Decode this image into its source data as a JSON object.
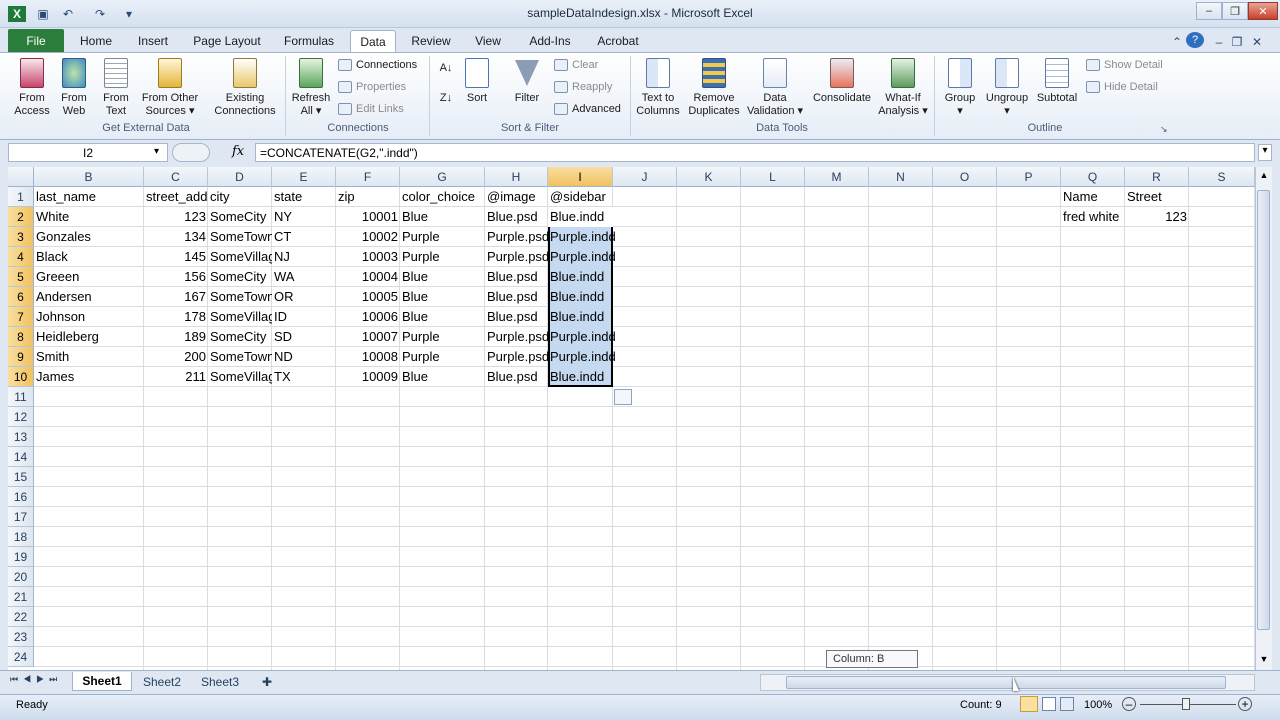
{
  "window": {
    "title": "sampleDataIndesign.xlsx  -  Microsoft Excel"
  },
  "tabs": [
    "File",
    "Home",
    "Insert",
    "Page Layout",
    "Formulas",
    "Data",
    "Review",
    "View",
    "Add-Ins",
    "Acrobat"
  ],
  "ribbon": {
    "get_external": {
      "from_access": "From\nAccess",
      "from_web": "From\nWeb",
      "from_text": "From\nText",
      "from_other": "From Other\nSources ▾",
      "existing": "Existing\nConnections",
      "label": "Get External Data"
    },
    "connections": {
      "refresh": "Refresh\nAll ▾",
      "connections": "Connections",
      "properties": "Properties",
      "edit_links": "Edit Links",
      "label": "Connections"
    },
    "sort_filter": {
      "sort": "Sort",
      "filter": "Filter",
      "clear": "Clear",
      "reapply": "Reapply",
      "advanced": "Advanced",
      "label": "Sort & Filter"
    },
    "data_tools": {
      "text_to_columns": "Text to\nColumns",
      "remove_duplicates": "Remove\nDuplicates",
      "data_validation": "Data\nValidation ▾",
      "consolidate": "Consolidate",
      "what_if": "What-If\nAnalysis ▾",
      "label": "Data Tools"
    },
    "outline": {
      "group": "Group\n▾",
      "ungroup": "Ungroup\n▾",
      "subtotal": "Subtotal",
      "show_detail": "Show Detail",
      "hide_detail": "Hide Detail",
      "label": "Outline"
    }
  },
  "formula_bar": {
    "name_box": "I2",
    "fx": "fx",
    "formula": "=CONCATENATE(G2,\".indd\")"
  },
  "columns": [
    "B",
    "C",
    "D",
    "E",
    "F",
    "G",
    "H",
    "I",
    "J",
    "K",
    "L",
    "M",
    "N",
    "O",
    "P",
    "Q",
    "R",
    "S"
  ],
  "rows": [
    "1",
    "2",
    "3",
    "4",
    "5",
    "6",
    "7",
    "8",
    "9",
    "10",
    "11",
    "12",
    "13",
    "14",
    "15",
    "16",
    "17",
    "18",
    "19",
    "20",
    "21",
    "22",
    "23",
    "24"
  ],
  "headers": {
    "B": "last_name",
    "C": "street_address",
    "D": "city",
    "E": "state",
    "F": "zip",
    "G": "color_choice",
    "H": "@image",
    "I": "@sidebar",
    "Q": "Name",
    "R": "Street"
  },
  "table": [
    [
      "White",
      "123",
      "SomeCity",
      "NY",
      "10001",
      "Blue",
      "Blue.psd",
      "Blue.indd"
    ],
    [
      "Gonzales",
      "134",
      "SomeTown",
      "CT",
      "10002",
      "Purple",
      "Purple.psd",
      "Purple.indd"
    ],
    [
      "Black",
      "145",
      "SomeVillage",
      "NJ",
      "10003",
      "Purple",
      "Purple.psd",
      "Purple.indd"
    ],
    [
      "Greeen",
      "156",
      "SomeCity",
      "WA",
      "10004",
      "Blue",
      "Blue.psd",
      "Blue.indd"
    ],
    [
      "Andersen",
      "167",
      "SomeTown",
      "OR",
      "10005",
      "Blue",
      "Blue.psd",
      "Blue.indd"
    ],
    [
      "Johnson",
      "178",
      "SomeVillage",
      "ID",
      "10006",
      "Blue",
      "Blue.psd",
      "Blue.indd"
    ],
    [
      "Heidleberg",
      "189",
      "SomeCity",
      "SD",
      "10007",
      "Purple",
      "Purple.psd",
      "Purple.indd"
    ],
    [
      "Smith",
      "200",
      "SomeTown",
      "ND",
      "10008",
      "Purple",
      "Purple.psd",
      "Purple.indd"
    ],
    [
      "James",
      "211",
      "SomeVillage",
      "TX",
      "10009",
      "Blue",
      "Blue.psd",
      "Blue.indd"
    ]
  ],
  "side_table": {
    "name": "fred white",
    "street": "123"
  },
  "sheets": [
    "Sheet1",
    "Sheet2",
    "Sheet3"
  ],
  "status": {
    "ready": "Ready",
    "count": "Count: 9",
    "zoom": "100%"
  },
  "tooltip": "Column: B"
}
